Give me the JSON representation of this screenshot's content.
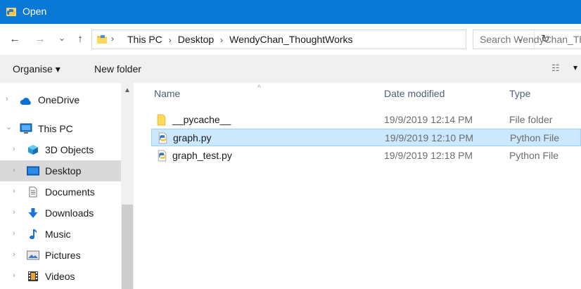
{
  "window": {
    "title": "Open",
    "icon": "python-open-icon"
  },
  "navigation": {
    "back": "←",
    "forward": "→",
    "recent": "⌄",
    "up": "↑"
  },
  "address": {
    "crumbs": [
      "This PC",
      "Desktop",
      "WendyChan_ThoughtWorks"
    ],
    "separator": "›",
    "dropdown": "⌄",
    "refresh": "↻"
  },
  "search": {
    "placeholder": "Search WendyChan_ThoughtWorks"
  },
  "toolbar": {
    "organise": "Organise ▾",
    "new_folder": "New folder",
    "view_glyph": "☷",
    "view_more": "▾"
  },
  "sidebar": {
    "items": [
      {
        "label": "OneDrive",
        "icon": "cloud-icon",
        "chevron": "›"
      },
      {
        "label": "This PC",
        "icon": "computer-icon",
        "chevron": "⌄"
      },
      {
        "label": "3D Objects",
        "icon": "cube-icon",
        "chevron": "›"
      },
      {
        "label": "Desktop",
        "icon": "desktop-icon",
        "chevron": "›",
        "selected": true
      },
      {
        "label": "Documents",
        "icon": "document-icon",
        "chevron": "›"
      },
      {
        "label": "Downloads",
        "icon": "download-icon",
        "chevron": "›"
      },
      {
        "label": "Music",
        "icon": "music-icon",
        "chevron": "›"
      },
      {
        "label": "Pictures",
        "icon": "picture-icon",
        "chevron": "›"
      },
      {
        "label": "Videos",
        "icon": "video-icon",
        "chevron": "›"
      }
    ],
    "scroll_up": "▲"
  },
  "files": {
    "columns": {
      "name": "Name",
      "date": "Date modified",
      "type": "Type",
      "sort_indicator": "^"
    },
    "rows": [
      {
        "name": "__pycache__",
        "date": "19/9/2019 12:14 PM",
        "type": "File folder",
        "icon": "folder-icon"
      },
      {
        "name": "graph.py",
        "date": "19/9/2019 12:10 PM",
        "type": "Python File",
        "icon": "python-file-icon",
        "selected": true
      },
      {
        "name": "graph_test.py",
        "date": "19/9/2019 12:18 PM",
        "type": "Python File",
        "icon": "python-file-icon"
      }
    ]
  },
  "colors": {
    "titlebar": "#0a78d7",
    "selection": "#cce8ff",
    "nav_selected": "#d9d9d9"
  }
}
